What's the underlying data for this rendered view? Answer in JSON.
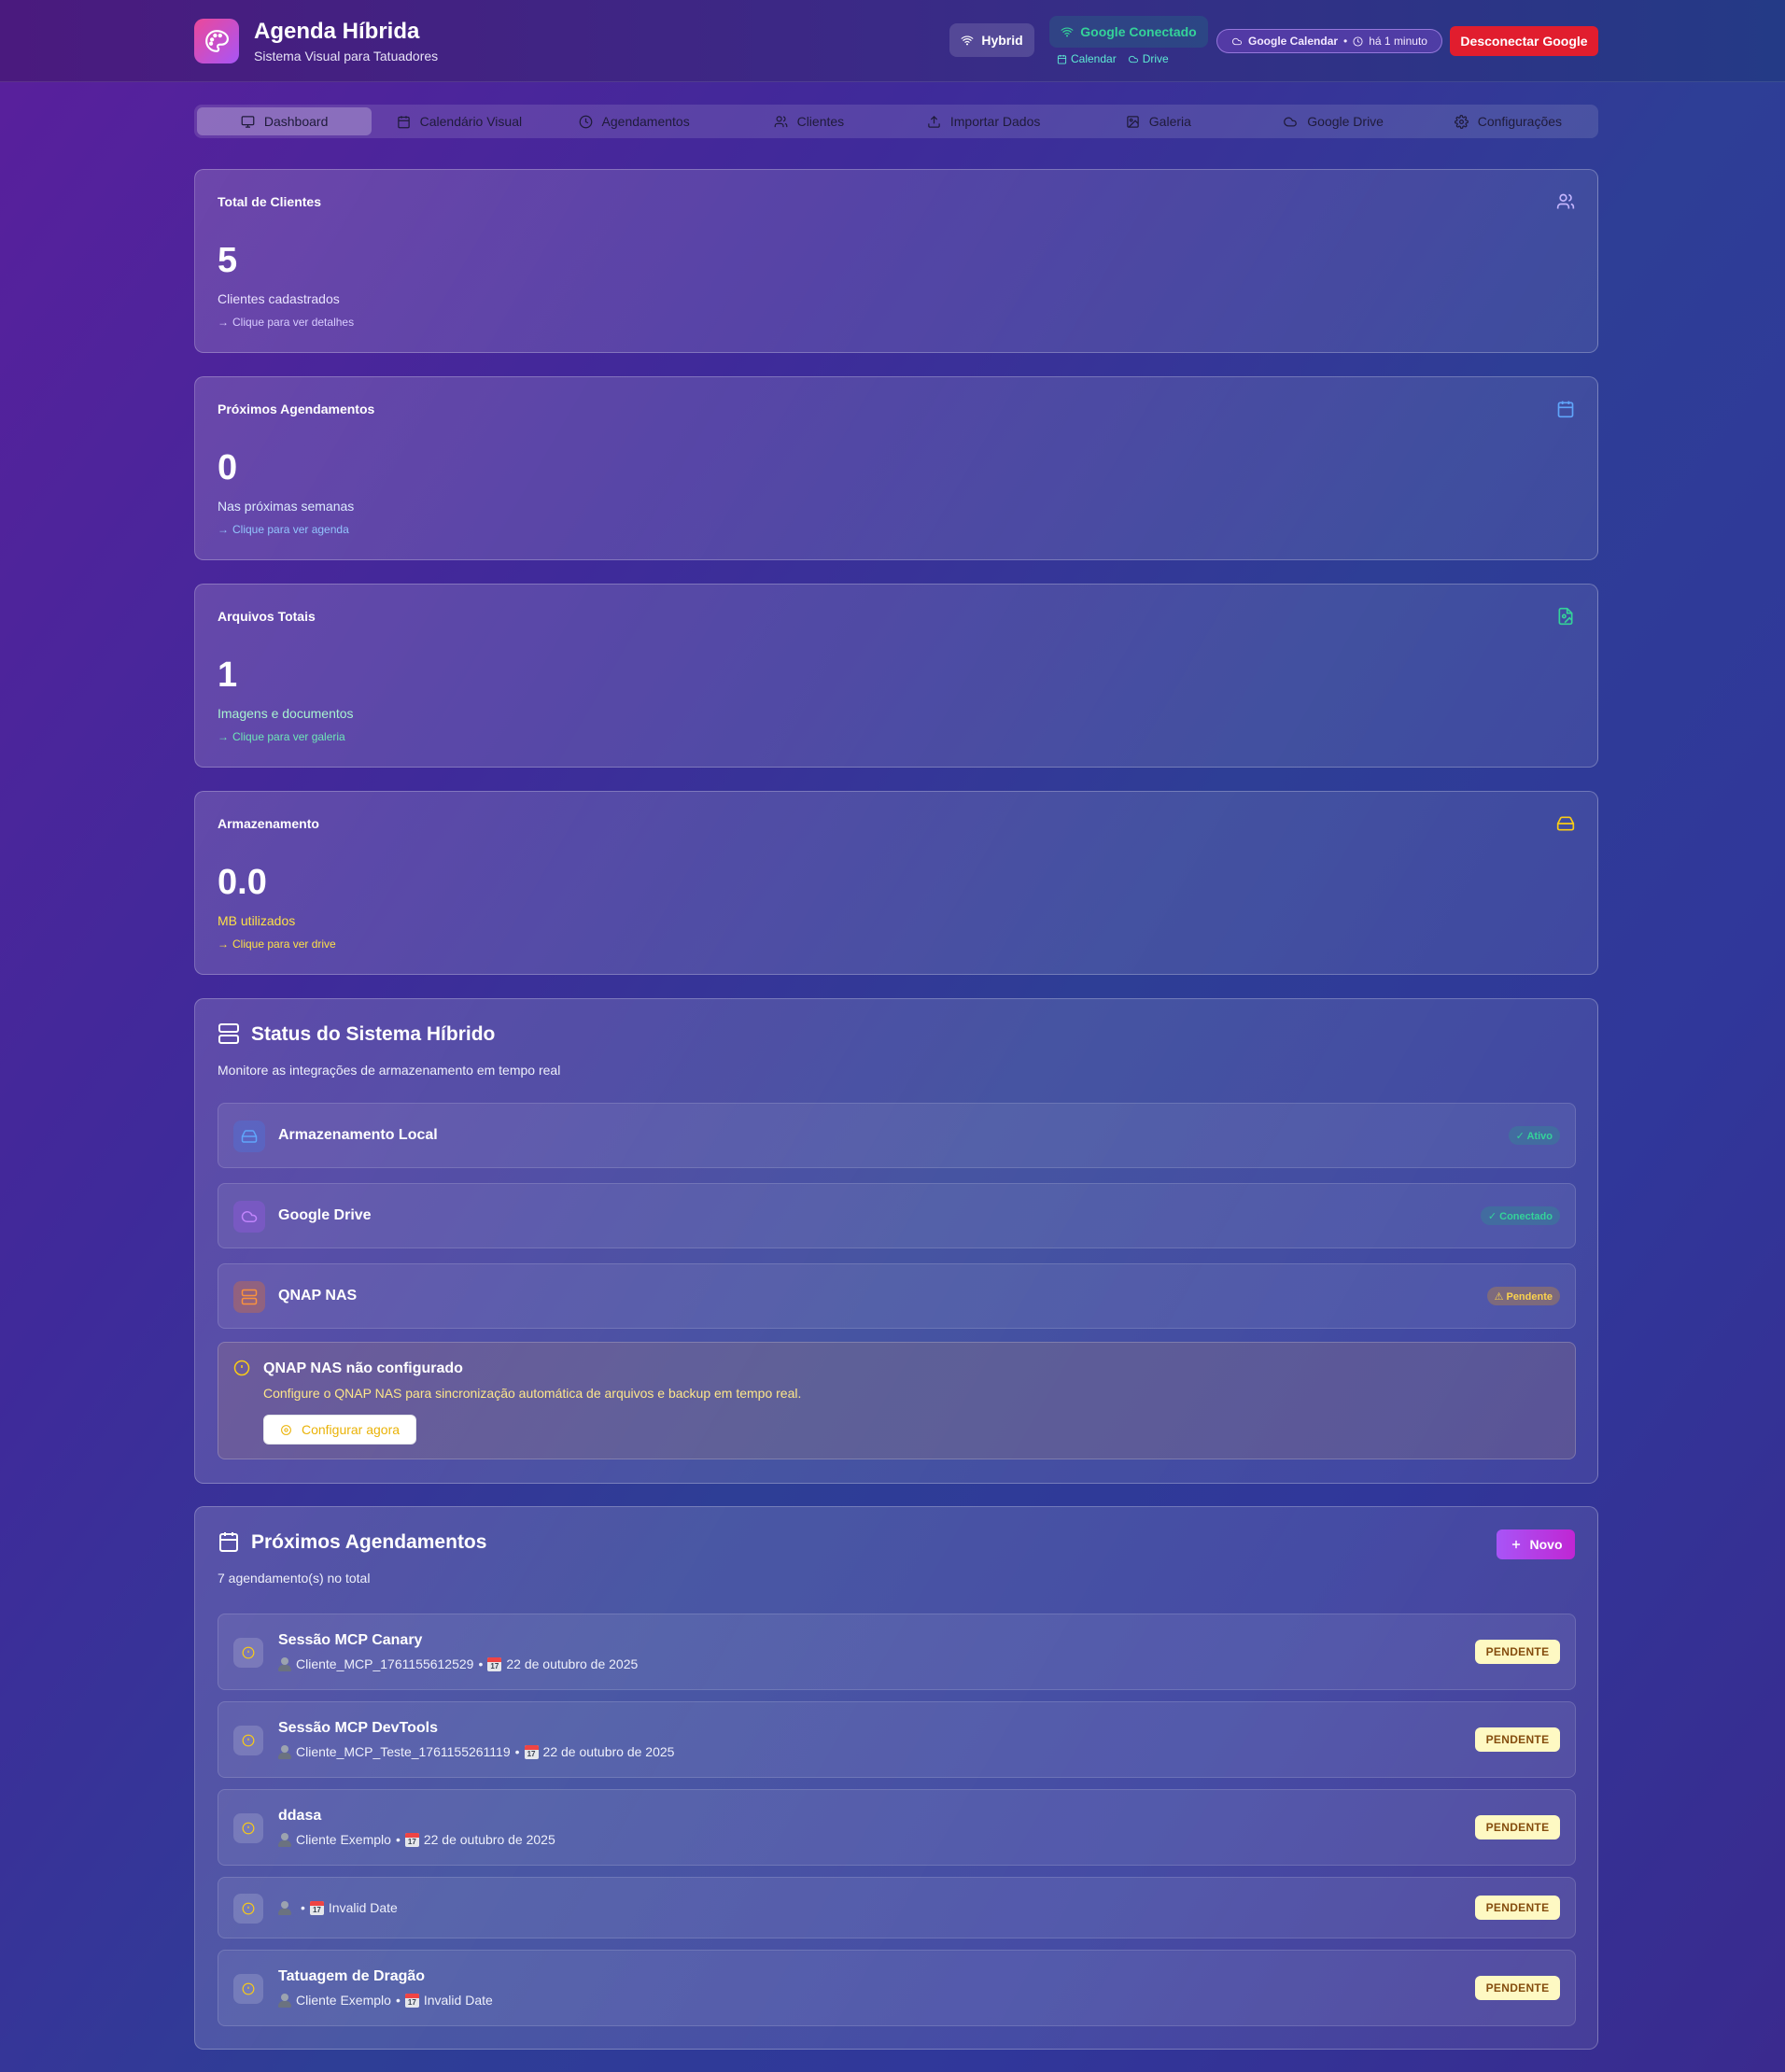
{
  "header": {
    "title": "Agenda Híbrida",
    "subtitle": "Sistema Visual para Tatuadores",
    "mode": "Hybrid",
    "google_status": "Google Conectado",
    "google_services": [
      "Calendar",
      "Drive"
    ],
    "sync_label": "Google Calendar",
    "sync_separator": "•",
    "sync_time": "há 1 minuto",
    "disconnect_label": "Desconectar Google"
  },
  "tabs": [
    {
      "label": "Dashboard",
      "icon": "monitor-icon",
      "active": true
    },
    {
      "label": "Calendário Visual",
      "icon": "calendar-icon"
    },
    {
      "label": "Agendamentos",
      "icon": "clock-icon"
    },
    {
      "label": "Clientes",
      "icon": "users-icon"
    },
    {
      "label": "Importar Dados",
      "icon": "upload-icon"
    },
    {
      "label": "Galeria",
      "icon": "image-icon"
    },
    {
      "label": "Google Drive",
      "icon": "cloud-icon"
    },
    {
      "label": "Configurações",
      "icon": "gear-icon"
    }
  ],
  "stats": [
    {
      "label": "Total de Clientes",
      "value": "5",
      "desc": "Clientes cadastrados",
      "link": "Clique para ver detalhes",
      "icon": "users-icon",
      "color": "#c4b5fd"
    },
    {
      "label": "Próximos Agendamentos",
      "value": "0",
      "desc": "Nas próximas semanas",
      "link": "Clique para ver agenda",
      "icon": "calendar-icon",
      "color": "#93c5fd"
    },
    {
      "label": "Arquivos Totais",
      "value": "1",
      "desc": "Imagens e documentos",
      "link": "Clique para ver galeria",
      "icon": "file-image-icon",
      "color": "#6ee7b7"
    },
    {
      "label": "Armazenamento",
      "value": "0.0",
      "desc": "MB utilizados",
      "link": "Clique para ver drive",
      "icon": "hard-drive-icon",
      "color": "#fde047"
    }
  ],
  "status": {
    "title": "Status do Sistema Híbrido",
    "subtitle": "Monitore as integrações de armazenamento em tempo real",
    "items": [
      {
        "name": "Armazenamento Local",
        "badge": "✓ Ativo",
        "icon": "hard-drive-icon"
      },
      {
        "name": "Google Drive",
        "badge": "✓ Conectado",
        "icon": "cloud-icon"
      },
      {
        "name": "QNAP NAS",
        "badge": "⚠ Pendente",
        "icon": "server-icon"
      }
    ],
    "warning": {
      "title": "QNAP NAS não configurado",
      "desc": "Configure o QNAP NAS para sincronização automática de arquivos e backup em tempo real.",
      "button": "Configurar agora"
    }
  },
  "appointments": {
    "title": "Próximos Agendamentos",
    "subtitle": "7 agendamento(s) no total",
    "new_label": "Novo",
    "cal_emoji_day": "17",
    "items": [
      {
        "title": "Sessão MCP Canary",
        "client": "Cliente_MCP_1761155612529",
        "date": "22 de outubro de 2025",
        "status": "PENDENTE"
      },
      {
        "title": "Sessão MCP DevTools",
        "client": "Cliente_MCP_Teste_1761155261119",
        "date": "22 de outubro de 2025",
        "status": "PENDENTE"
      },
      {
        "title": "ddasa",
        "client": "Cliente Exemplo",
        "date": "22 de outubro de 2025",
        "status": "PENDENTE"
      },
      {
        "title": "",
        "client": "",
        "date": "Invalid Date",
        "status": "PENDENTE"
      },
      {
        "title": "Tatuagem de Dragão",
        "client": "Cliente Exemplo",
        "date": "Invalid Date",
        "status": "PENDENTE"
      }
    ]
  }
}
